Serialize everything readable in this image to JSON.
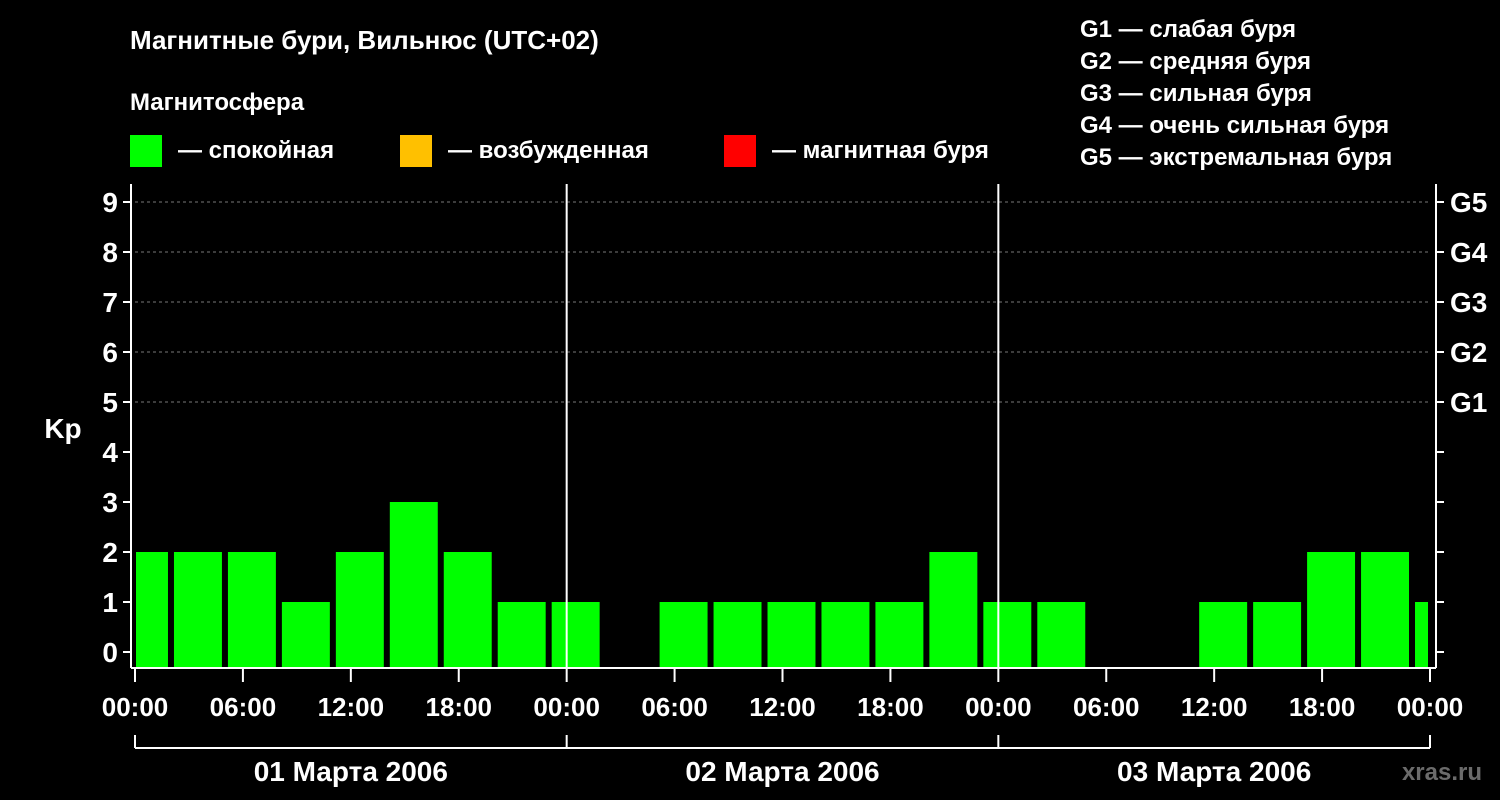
{
  "chart_data": {
    "type": "bar",
    "title": "Магнитные бури, Вильнюс (UTC+02)",
    "subtitle": "Магнитосфера",
    "ylabel": "Kp",
    "ylim": [
      0,
      9
    ],
    "grid": true,
    "yticks": [
      "0",
      "1",
      "2",
      "3",
      "4",
      "5",
      "6",
      "7",
      "8",
      "9"
    ],
    "right_ticks": [
      {
        "kp": 5,
        "label": "G1"
      },
      {
        "kp": 6,
        "label": "G2"
      },
      {
        "kp": 7,
        "label": "G3"
      },
      {
        "kp": 8,
        "label": "G4"
      },
      {
        "kp": 9,
        "label": "G5"
      }
    ],
    "xticks": [
      "00:00",
      "06:00",
      "12:00",
      "18:00",
      "00:00",
      "06:00",
      "12:00",
      "18:00",
      "00:00",
      "06:00",
      "12:00",
      "18:00",
      "00:00"
    ],
    "days": [
      "01 Марта 2006",
      "02 Марта 2006",
      "03 Марта 2006"
    ],
    "legend_states": [
      {
        "label": "— спокойная",
        "color": "#00ff00"
      },
      {
        "label": "— возбужденная",
        "color": "#ffc000"
      },
      {
        "label": "— магнитная буря",
        "color": "#ff0000"
      }
    ],
    "storm_scale": [
      "G1 — слабая буря",
      "G2 — средняя буря",
      "G3 — сильная буря",
      "G4 — очень сильная буря",
      "G5 — экстремальная буря"
    ],
    "bars": [
      {
        "start_hour": 0,
        "end_hour": 2,
        "kp": 2
      },
      {
        "start_hour": 2,
        "end_hour": 5,
        "kp": 2
      },
      {
        "start_hour": 5,
        "end_hour": 8,
        "kp": 2
      },
      {
        "start_hour": 8,
        "end_hour": 11,
        "kp": 1
      },
      {
        "start_hour": 11,
        "end_hour": 14,
        "kp": 2
      },
      {
        "start_hour": 14,
        "end_hour": 17,
        "kp": 3
      },
      {
        "start_hour": 17,
        "end_hour": 20,
        "kp": 2
      },
      {
        "start_hour": 20,
        "end_hour": 23,
        "kp": 1
      },
      {
        "start_hour": 23,
        "end_hour": 26,
        "kp": 1
      },
      {
        "start_hour": 26,
        "end_hour": 29,
        "kp": 0
      },
      {
        "start_hour": 29,
        "end_hour": 32,
        "kp": 1
      },
      {
        "start_hour": 32,
        "end_hour": 35,
        "kp": 1
      },
      {
        "start_hour": 35,
        "end_hour": 38,
        "kp": 1
      },
      {
        "start_hour": 38,
        "end_hour": 41,
        "kp": 1
      },
      {
        "start_hour": 41,
        "end_hour": 44,
        "kp": 1
      },
      {
        "start_hour": 44,
        "end_hour": 47,
        "kp": 2
      },
      {
        "start_hour": 47,
        "end_hour": 50,
        "kp": 1
      },
      {
        "start_hour": 50,
        "end_hour": 53,
        "kp": 1
      },
      {
        "start_hour": 53,
        "end_hour": 56,
        "kp": 0
      },
      {
        "start_hour": 56,
        "end_hour": 59,
        "kp": 0
      },
      {
        "start_hour": 59,
        "end_hour": 62,
        "kp": 1
      },
      {
        "start_hour": 62,
        "end_hour": 65,
        "kp": 1
      },
      {
        "start_hour": 65,
        "end_hour": 68,
        "kp": 2
      },
      {
        "start_hour": 68,
        "end_hour": 71,
        "kp": 2
      },
      {
        "start_hour": 71,
        "end_hour": 72,
        "kp": 1
      }
    ]
  },
  "watermark": "xras.ru"
}
